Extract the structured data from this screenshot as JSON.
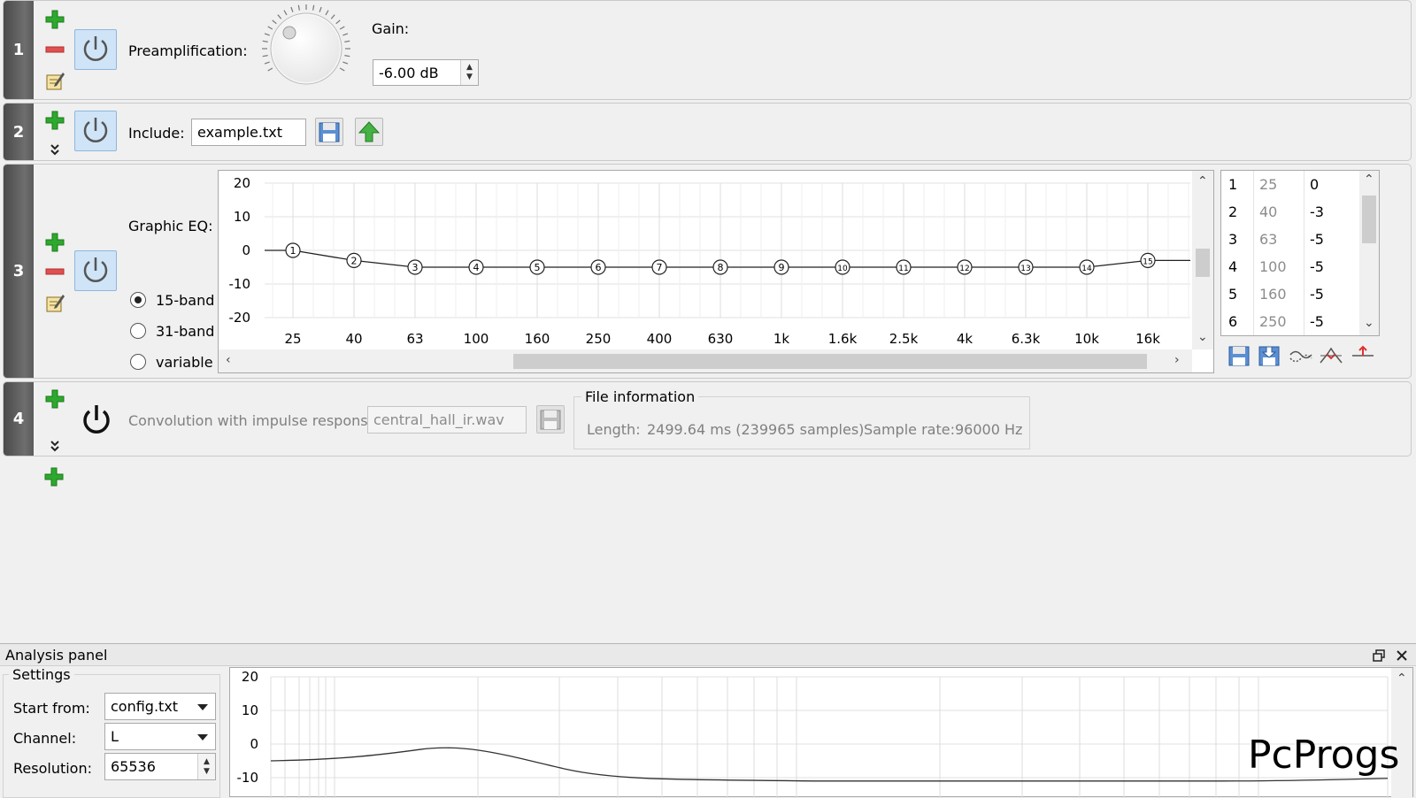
{
  "rows": [
    {
      "number": "1",
      "preamp_label": "Preamplification:",
      "gain_label": "Gain:",
      "gain_value": "-6.00 dB"
    },
    {
      "number": "2",
      "include_label": "Include:",
      "include_file": "example.txt"
    },
    {
      "number": "3",
      "eq_label": "Graphic EQ:",
      "band_options": [
        "15-band",
        "31-band",
        "variable"
      ],
      "selected_band": "15-band"
    },
    {
      "number": "4",
      "convolution_label": "Convolution with impulse response:",
      "convolution_file": "central_hall_ir.wav",
      "file_info_title": "File information",
      "length_label": "Length:",
      "length_value": "2499.64 ms (239965 samples)",
      "sample_rate_label": "Sample rate:",
      "sample_rate_value": "96000 Hz"
    }
  ],
  "eq_table": [
    {
      "index": "1",
      "freq": "25",
      "gain": "0"
    },
    {
      "index": "2",
      "freq": "40",
      "gain": "-3"
    },
    {
      "index": "3",
      "freq": "63",
      "gain": "-5"
    },
    {
      "index": "4",
      "freq": "100",
      "gain": "-5"
    },
    {
      "index": "5",
      "freq": "160",
      "gain": "-5"
    },
    {
      "index": "6",
      "freq": "250",
      "gain": "-5"
    }
  ],
  "chart_data": {
    "type": "line",
    "categories": [
      "25",
      "40",
      "63",
      "100",
      "160",
      "250",
      "400",
      "630",
      "1k",
      "1.6k",
      "2.5k",
      "4k",
      "6.3k",
      "10k",
      "16k"
    ],
    "point_labels": [
      "1",
      "2",
      "3",
      "4",
      "5",
      "6",
      "7",
      "8",
      "9",
      "10",
      "11",
      "12",
      "13",
      "14",
      "15"
    ],
    "values": [
      0,
      -3,
      -5,
      -5,
      -5,
      -5,
      -5,
      -5,
      -5,
      -5,
      -5,
      -5,
      -5,
      -5,
      -3
    ],
    "y_ticks": [
      "20",
      "10",
      "0",
      "-10",
      "-20"
    ],
    "ylim": [
      -20,
      20
    ],
    "grid": true
  },
  "analysis": {
    "title": "Analysis panel",
    "settings_title": "Settings",
    "start_from_label": "Start from:",
    "start_from_value": "config.txt",
    "channel_label": "Channel:",
    "channel_value": "L",
    "resolution_label": "Resolution:",
    "resolution_value": "65536",
    "y_ticks": [
      "20",
      "10",
      "0",
      "-10"
    ]
  },
  "watermark": "PcProgs",
  "colors": {
    "accent": "#cfe4f7",
    "plus": "#2ea82e",
    "minus": "#e05050",
    "number_bar": "#5a5a5a"
  }
}
